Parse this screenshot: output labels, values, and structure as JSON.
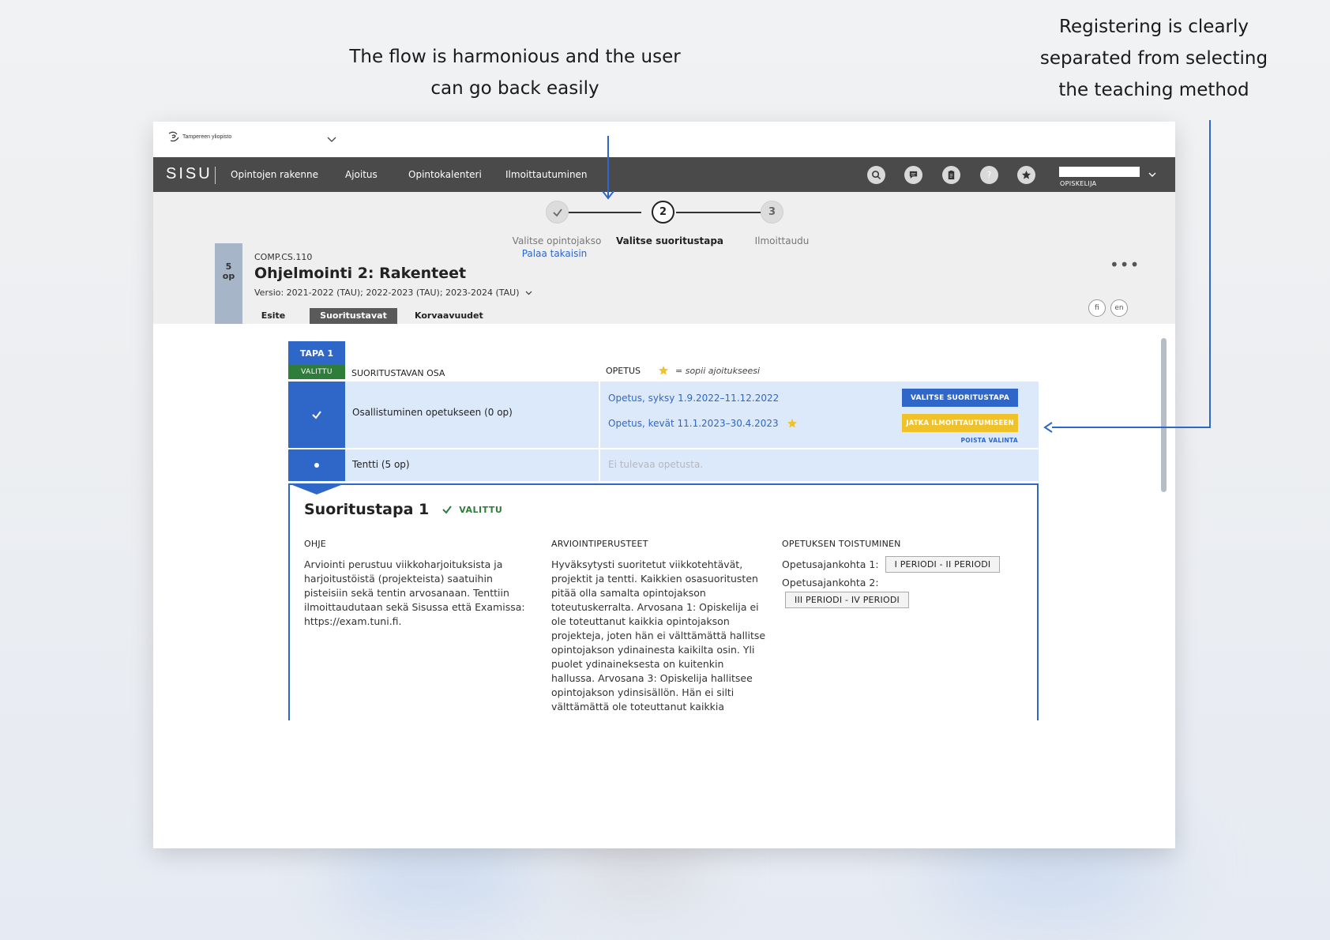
{
  "annotations": {
    "flow": [
      "The flow is harmonious and the user",
      "can go back easily"
    ],
    "register": [
      "Registering is clearly",
      "separated from selecting",
      "the teaching method"
    ]
  },
  "university": {
    "name": "Tampereen yliopisto"
  },
  "nav": {
    "logo": "SISU",
    "items": [
      "Opintojen rakenne",
      "Ajoitus",
      "Opintokalenteri",
      "Ilmoittautuminen"
    ],
    "icons": [
      "search-icon",
      "message-icon",
      "clipboard-icon",
      "help-icon",
      "star-icon"
    ],
    "user_role": "OPISKELIJA"
  },
  "stepper": {
    "steps": [
      {
        "number": "1",
        "label": "Valitse opintojakso",
        "status": "done"
      },
      {
        "number": "2",
        "label": "Valitse suoritustapa",
        "status": "active"
      },
      {
        "number": "3",
        "label": "Ilmoittaudu",
        "status": "future"
      }
    ],
    "back_link": "Palaa takaisin"
  },
  "course": {
    "credits_value": "5",
    "credits_unit": "op",
    "code": "COMP.CS.110",
    "title": "Ohjelmointi 2: Rakenteet",
    "version": "Versio: 2021-2022 (TAU); 2022-2023 (TAU); 2023-2024 (TAU)",
    "more": "•••",
    "languages": [
      "fi",
      "en"
    ],
    "tabs": [
      "Esite",
      "Suoritustavat",
      "Korvaavuudet"
    ],
    "active_tab": "Suoritustavat"
  },
  "completion": {
    "tapa_label": "TAPA 1",
    "selected_badge": "VALITTU",
    "col_part": "SUORITUSTAVAN OSA",
    "col_teaching": "OPETUS",
    "legend": "= sopii ajoitukseesi",
    "rows": [
      {
        "part": "Osallistuminen opetukseen (0 op)",
        "teachings": [
          "Opetus, syksy 1.9.2022–11.12.2022",
          "Opetus, kevät 11.1.2023–30.4.2023"
        ]
      },
      {
        "part": "Tentti (5 op)",
        "no_teaching": "Ei tulevaa opetusta."
      }
    ],
    "btn_select": "VALITSE SUORITUSTAPA",
    "btn_continue": "JATKA ILMOITTAUTUMISEEN",
    "remove_link": "POISTA VALINTA"
  },
  "panel": {
    "title": "Suoritustapa 1",
    "badge": "VALITTU",
    "sections": {
      "ohje_head": "OHJE",
      "ohje_lines": [
        "Arviointi perustuu viikkoharjoituksista ja",
        "harjoitustöistä (projekteista) saatuihin",
        "pisteisiin sekä tentin arvosanaan. Tenttiin",
        "ilmoittaudutaan sekä Sisussa että Examissa:",
        "https://exam.tuni.fi."
      ],
      "arv_head": "ARVIOINTIPERUSTEET",
      "arv_lines": [
        "Hyväksytysti suoritetut viikkotehtävät,",
        "projektit ja tentti. Kaikkien osasuoritusten",
        "pitää olla samalta opintojakson",
        "toteutuskerralta. Arvosana 1: Opiskelija ei",
        "ole toteuttanut kaikkia opintojakson",
        "projekteja, joten hän ei välttämättä hallitse",
        "opintojakson ydinainesta kaikilta osin. Yli",
        "puolet ydinaineksesta on kuitenkin",
        "hallussa. Arvosana 3: Opiskelija hallitsee",
        "opintojakson ydinsisällön. Hän ei silti",
        "välttämättä ole toteuttanut kaikkia"
      ],
      "rep_head": "OPETUKSEN TOISTUMINEN",
      "rep_label1": "Opetusajankohta 1:",
      "rep_chip1": "I PERIODI - II PERIODI",
      "rep_label2": "Opetusajankohta 2:",
      "rep_chip2": "III PERIODI - IV PERIODI"
    }
  },
  "colors": {
    "brand_blue": "#2f67c8",
    "success_green": "#2e7d3a",
    "warning_yellow": "#f0c229",
    "nav_dark": "#4a4a4a"
  }
}
